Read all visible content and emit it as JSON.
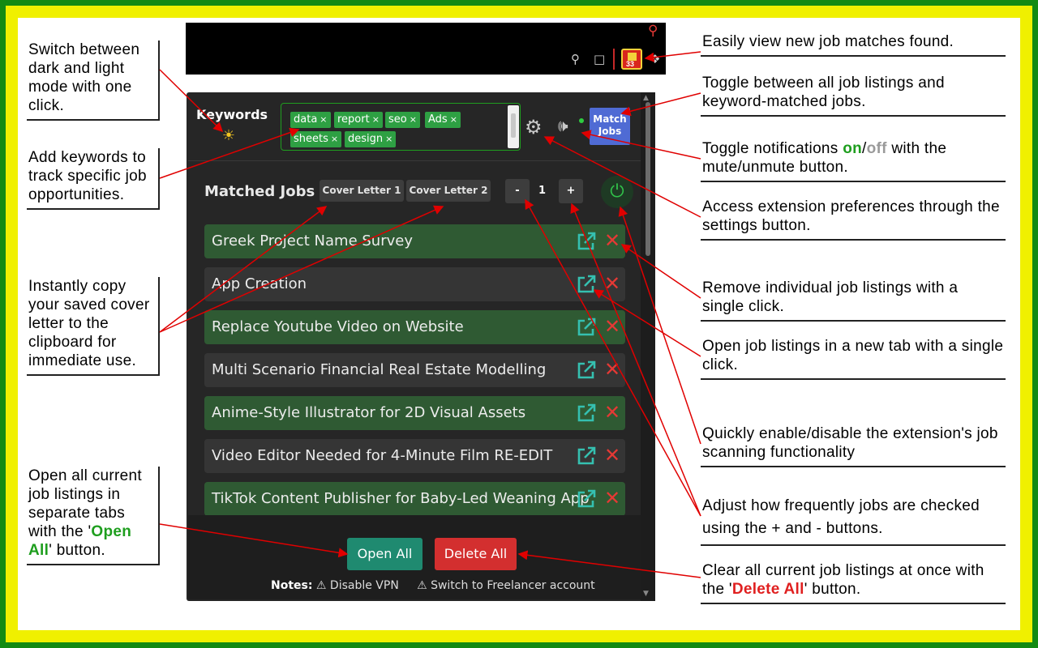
{
  "colors": {
    "outer_frame": "#138a13",
    "inner_frame": "#f0f000",
    "popup_bg": "#262626",
    "accent_green": "#2ea043",
    "accent_red": "#d32f2f",
    "match_btn": "#4f6bd4",
    "open_all": "#1f8a70"
  },
  "browser": {
    "badge_count": "33",
    "icons": [
      "search-icon",
      "pin-icon",
      "screenshot-icon",
      "extension-badge-icon",
      "puzzle-icon"
    ]
  },
  "popup": {
    "keywords_label": "Keywords",
    "keywords": [
      "data",
      "report",
      "seo",
      "Ads",
      "sheets",
      "design"
    ],
    "chip_remove": "×",
    "match_jobs_line1": "Match",
    "match_jobs_line2": "Jobs",
    "matched_jobs_label": "Matched Jobs",
    "cover_letter_1": "Cover Letter 1",
    "cover_letter_2": "Cover Letter 2",
    "decrement": "-",
    "increment": "+",
    "interval_value": "1",
    "jobs": [
      {
        "title": "Greek Project Name Survey",
        "highlight": true
      },
      {
        "title": "App Creation",
        "highlight": false
      },
      {
        "title": "Replace Youtube Video on Website",
        "highlight": true
      },
      {
        "title": "Multi Scenario Financial Real Estate Modelling",
        "highlight": false
      },
      {
        "title": "Anime-Style Illustrator for 2D Visual Assets",
        "highlight": true
      },
      {
        "title": "Video Editor Needed for 4-Minute Film RE-EDIT",
        "highlight": false
      },
      {
        "title": "TikTok Content Publisher for Baby-Led Weaning App",
        "highlight": true
      }
    ],
    "open_all": "Open All",
    "delete_all": "Delete All",
    "notes_label": "Notes:",
    "note_1": "⚠ Disable VPN",
    "note_2": "⚠ Switch to Freelancer account"
  },
  "callouts_left": {
    "dark_mode": "Switch between dark and light mode with one click.",
    "keywords": "Add keywords to track specific job opportunities.",
    "cover_letter": "Instantly copy your saved cover letter to the clipboard for immediate use.",
    "open_all_pre": "Open all current job listings in separate tabs with the '",
    "open_all_em": "Open All",
    "open_all_post": "' button."
  },
  "callouts_right": {
    "badge": "Easily view new job matches found.",
    "toggle_listings": "Toggle between all job listings and keyword-matched jobs.",
    "notif_pre": "Toggle notifications ",
    "notif_on": "on",
    "notif_slash": "/",
    "notif_off": "off",
    "notif_post": " with the mute/unmute button.",
    "settings": "Access extension preferences through the settings button.",
    "remove": "Remove individual job listings with a single click.",
    "open_tab": "Open job listings in a new tab with a single click.",
    "enable": "Quickly enable/disable the extension's job scanning functionality",
    "adjust": "Adjust how frequently jobs are checked using the + and - buttons.",
    "clear_pre": "Clear all current job listings at once with the '",
    "clear_em": "Delete All",
    "clear_post": "' button."
  }
}
